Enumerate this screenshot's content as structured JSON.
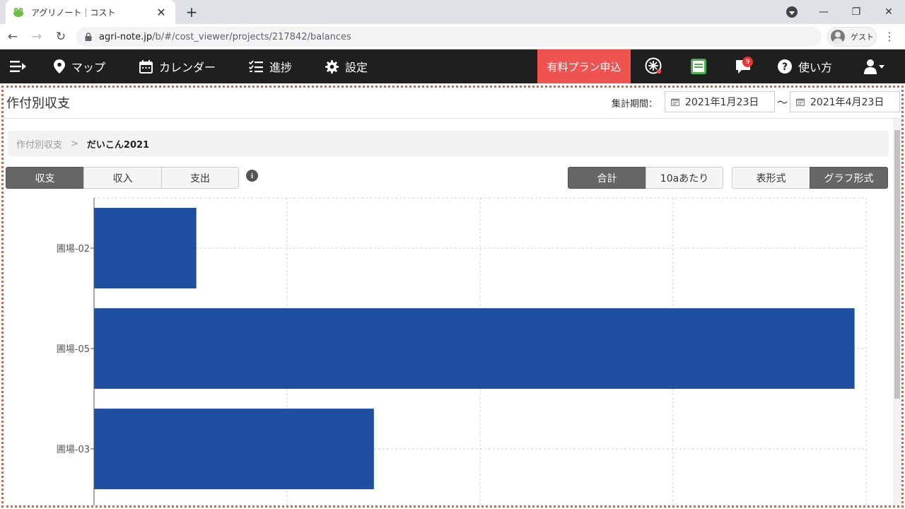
{
  "browser": {
    "tab_title": "アグリノート｜コスト",
    "url_host": "agri-note.jp",
    "url_path": "/b/#/cost_viewer/projects/217842/balances",
    "profile_label": "ゲスト"
  },
  "navbar": {
    "map": "マップ",
    "calendar": "カレンダー",
    "progress": "進捗",
    "settings": "設定",
    "promo": "有料プラン申込",
    "notification_count": "9",
    "help": "使い方"
  },
  "header": {
    "title": "作付別収支",
    "period_label": "集計期間：",
    "date_from": "2021年1月23日",
    "tilde": "〜",
    "date_to": "2021年4月23日"
  },
  "breadcrumb": {
    "parent": "作付別収支",
    "separator": ">",
    "current": "だいこん2021"
  },
  "tabs": {
    "balance": "収支",
    "income": "収入",
    "expense": "支出",
    "total": "合計",
    "per10a": "10aあたり",
    "table": "表形式",
    "graph": "グラフ形式",
    "active_view": "balance",
    "active_unit": "total",
    "active_format": "graph"
  },
  "colors": {
    "bar": "#1e4fa0",
    "navbar": "#1f1f1f",
    "promo": "#ef5350"
  },
  "chart_data": {
    "type": "bar",
    "orientation": "horizontal",
    "categories": [
      "圃場-02",
      "圃場-05",
      "圃場-03"
    ],
    "values": [
      0.53,
      3.94,
      1.45
    ],
    "xlim": [
      0,
      4
    ],
    "grid": true
  }
}
